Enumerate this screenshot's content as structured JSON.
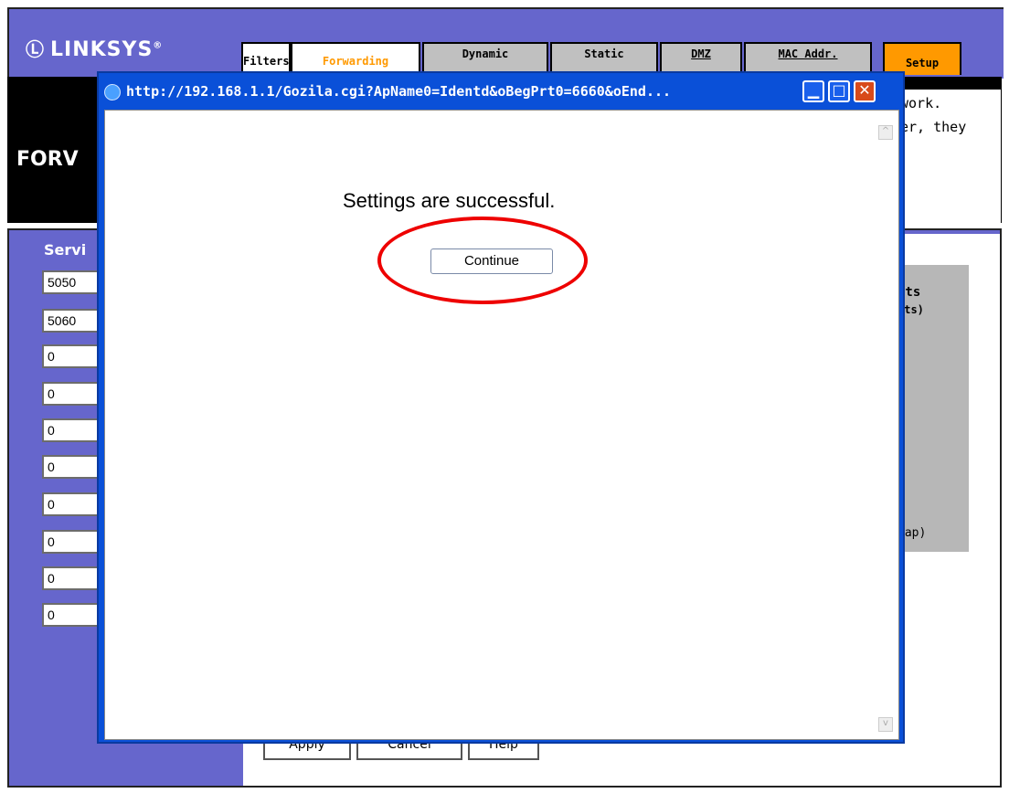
{
  "background_page": {
    "brand": "LINKSYS",
    "brand_mark": "Ⓛ",
    "brand_suffix": "®",
    "tabs": [
      {
        "label": "Filters"
      },
      {
        "label": "Forwarding"
      },
      {
        "label": "Dynamic"
      },
      {
        "label": "Static"
      },
      {
        "label": "DMZ"
      },
      {
        "label": "MAC Addr."
      },
      {
        "label": "Setup"
      }
    ],
    "section_title": "FORV",
    "desc_lines": [
      "work.",
      "er, they"
    ],
    "service_label": "Servi",
    "port_fields": [
      "5050",
      "5060",
      "0",
      "0",
      "0",
      "0",
      "0",
      "0",
      "0",
      "0"
    ],
    "gray_panel_lines": [
      "rts",
      "rts)",
      ")",
      "rap)"
    ],
    "bottom_buttons": [
      "Apply",
      "Cancel",
      "Help"
    ]
  },
  "popup": {
    "title": "http://192.168.1.1/Gozila.cgi?ApName0=Identd&oBegPrt0=6660&oEnd...",
    "min_glyph": "▁",
    "max_glyph": "□",
    "close_glyph": "✕",
    "scroll_up_glyph": "^",
    "scroll_down_glyph": "v",
    "message": "Settings are successful.",
    "continue_label": "Continue"
  },
  "colors": {
    "linksys_purple": "#6666cc",
    "tab_orange": "#ff9900",
    "xp_title_blue": "#0a50d8",
    "highlight_red": "#ee0000"
  }
}
